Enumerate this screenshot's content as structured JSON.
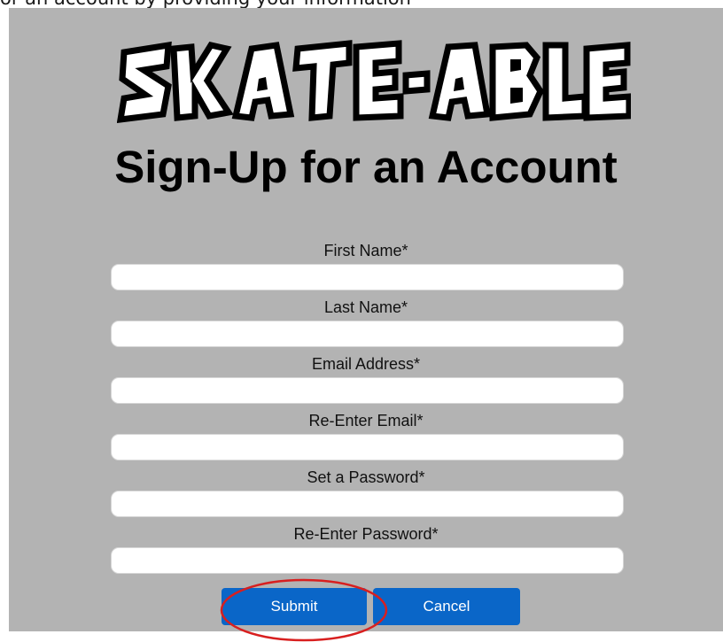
{
  "caption": "or an account by providing your information",
  "logo": {
    "text": "SKATE-ABLE"
  },
  "page_title": "Sign-Up for an Account",
  "form": {
    "fields": [
      {
        "label": "First Name*",
        "value": ""
      },
      {
        "label": "Last Name*",
        "value": ""
      },
      {
        "label": "Email Address*",
        "value": ""
      },
      {
        "label": "Re-Enter Email*",
        "value": ""
      },
      {
        "label": "Set a Password*",
        "value": ""
      },
      {
        "label": "Re-Enter Password*",
        "value": ""
      }
    ],
    "submit_label": "Submit",
    "cancel_label": "Cancel"
  },
  "colors": {
    "panel_background": "#b3b3b3",
    "button_blue": "#0a66c8",
    "annotation_red": "#d81f1f"
  }
}
